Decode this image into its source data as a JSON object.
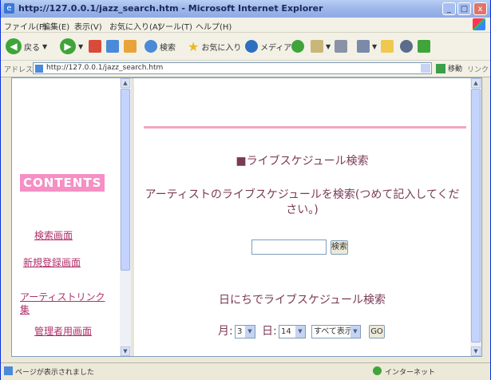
{
  "window": {
    "title": "http://127.0.0.1/jazz_search.htm - Microsoft Internet Explorer",
    "minimize": "_",
    "maximize": "□",
    "close": "x"
  },
  "menu": [
    "ファイル(F)",
    "編集(E)",
    "表示(V)",
    "お気に入り(A)",
    "ツール(T)",
    "ヘルプ(H)"
  ],
  "toolbar": {
    "back_label": "戻る",
    "search_label": "検索",
    "favorites_label": "お気に入り",
    "media_label": "メディア"
  },
  "address": {
    "label": "アドレス(D)",
    "url": "http://127.0.0.1/jazz_search.htm",
    "go_label": "移動",
    "links_label": "リンク"
  },
  "sidebar": {
    "badge": "CONTENTS",
    "links": [
      "検索画面",
      "新規登録画面",
      "アーティストリンク集",
      "管理者用画面"
    ]
  },
  "main": {
    "title": "■ライブスケジュール検索",
    "instruction_line1": "アーティストのライブスケジュールを検索(つめて記入してくだ",
    "instruction_line2": "さい。)",
    "search_button": "検索",
    "date_title": "日にちでライブスケジュール検索",
    "month_label": "月:",
    "month_value": "3",
    "day_label": "日:",
    "day_value": "14",
    "filter_value": "すべて表示",
    "date_go_button": "GO"
  },
  "status": {
    "text": "ページが表示されました",
    "zone": "インターネット"
  }
}
